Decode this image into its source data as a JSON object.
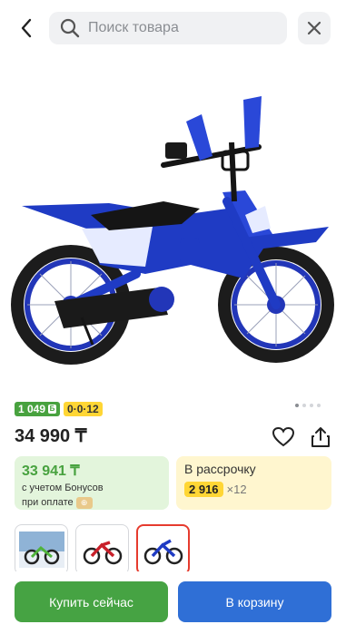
{
  "header": {
    "search_placeholder": "Поиск товара"
  },
  "gallery": {
    "dots_total": 4,
    "active_index": 0
  },
  "badges": {
    "bonus": "1 049",
    "installment": "0·0·12"
  },
  "price": "34 990 ₸",
  "bonus_card": {
    "amount": "33 941 ₸",
    "line1": "с учетом Бонусов",
    "line2": "при оплате"
  },
  "installment_card": {
    "label": "В рассрочку",
    "monthly": "2 916",
    "months": "×12"
  },
  "thumbnails": [
    "green-bike-photo",
    "red-bike-photo",
    "blue-bike-photo"
  ],
  "actions": {
    "buy_now": "Купить сейчас",
    "add_to_cart": "В корзину"
  },
  "colors": {
    "green": "#46a343",
    "blue": "#2f6fd6",
    "yellow": "#ffd635",
    "selected_border": "#e63b2e"
  }
}
